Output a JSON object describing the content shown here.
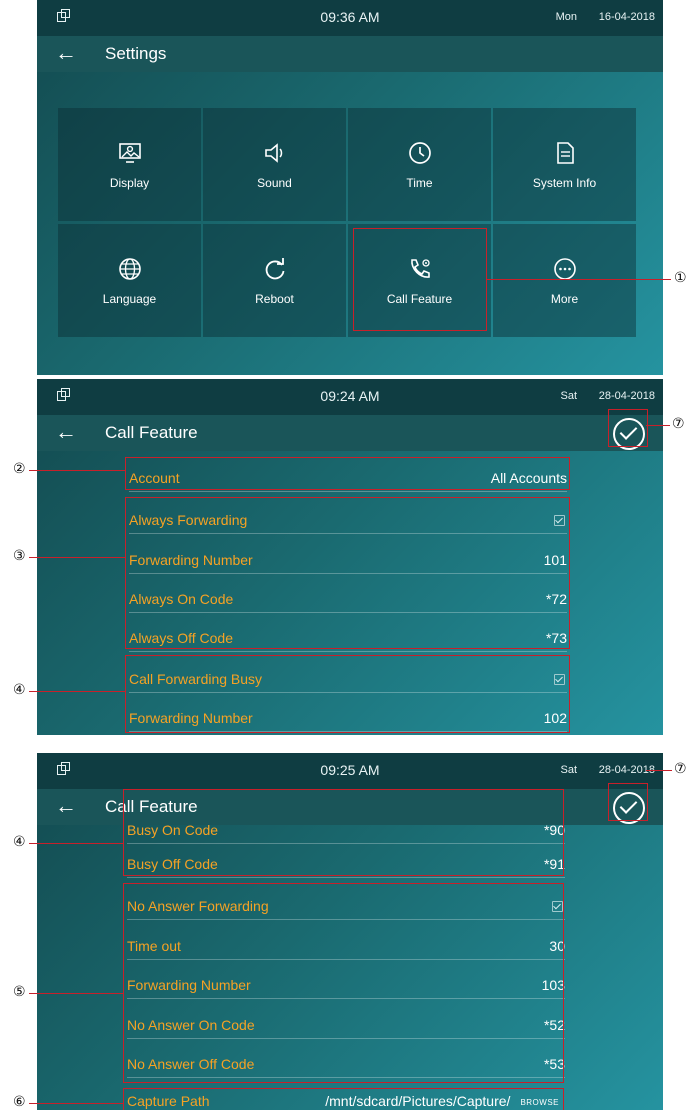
{
  "screen1": {
    "status": {
      "time": "09:36 AM",
      "day": "Mon",
      "date": "16-04-2018"
    },
    "title": "Settings",
    "tiles": [
      {
        "label": "Display",
        "icon": "display-icon"
      },
      {
        "label": "Sound",
        "icon": "sound-icon"
      },
      {
        "label": "Time",
        "icon": "clock-icon"
      },
      {
        "label": "System Info",
        "icon": "system-info-icon"
      },
      {
        "label": "Language",
        "icon": "globe-icon"
      },
      {
        "label": "Reboot",
        "icon": "reboot-icon"
      },
      {
        "label": "Call Feature",
        "icon": "call-feature-icon"
      },
      {
        "label": "More",
        "icon": "more-icon"
      }
    ]
  },
  "screen2": {
    "status": {
      "time": "09:24 AM",
      "day": "Sat",
      "date": "28-04-2018"
    },
    "title": "Call Feature",
    "rows": [
      {
        "label": "Account",
        "value": "All Accounts"
      },
      {
        "label": "Always Forwarding",
        "value": "",
        "checkbox": true
      },
      {
        "label": "Forwarding Number",
        "value": "101"
      },
      {
        "label": "Always On Code",
        "value": "*72"
      },
      {
        "label": "Always Off Code",
        "value": "*73"
      },
      {
        "label": "Call Forwarding Busy",
        "value": "",
        "checkbox": true
      },
      {
        "label": "Forwarding Number",
        "value": "102"
      }
    ]
  },
  "screen3": {
    "status": {
      "time": "09:25 AM",
      "day": "Sat",
      "date": "28-04-2018"
    },
    "title": "Call Feature",
    "rows": [
      {
        "label": "Busy On Code",
        "value": "*90"
      },
      {
        "label": "Busy Off Code",
        "value": "*91"
      },
      {
        "label": "No Answer Forwarding",
        "value": "",
        "checkbox": true
      },
      {
        "label": "Time out",
        "value": "30"
      },
      {
        "label": "Forwarding Number",
        "value": "103"
      },
      {
        "label": "No Answer On Code",
        "value": "*52"
      },
      {
        "label": "No Answer Off Code",
        "value": "*53"
      }
    ],
    "capture": {
      "label": "Capture Path",
      "path": "/mnt/sdcard/Pictures/Capture/",
      "browse": "BROWSE"
    }
  },
  "callouts": {
    "c1": "①",
    "c2": "②",
    "c3": "③",
    "c4": "④",
    "c5": "⑤",
    "c6": "⑥",
    "c7": "⑦"
  },
  "colors": {
    "accent": "#f6a224",
    "highlight": "#c8202a",
    "statusbar": "#0f3d42"
  }
}
